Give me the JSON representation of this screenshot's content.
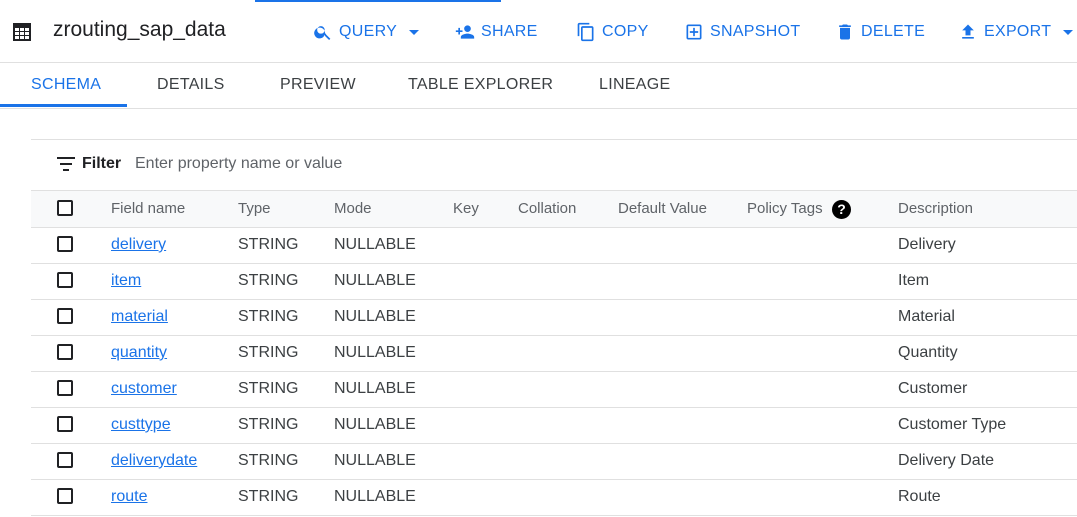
{
  "header": {
    "title": "zrouting_sap_data",
    "actions": {
      "query": "QUERY",
      "share": "SHARE",
      "copy": "COPY",
      "snapshot": "SNAPSHOT",
      "delete": "DELETE",
      "export": "EXPORT"
    }
  },
  "tabs": [
    "SCHEMA",
    "DETAILS",
    "PREVIEW",
    "TABLE EXPLORER",
    "LINEAGE"
  ],
  "active_tab": "SCHEMA",
  "filter": {
    "label": "Filter",
    "placeholder": "Enter property name or value"
  },
  "table": {
    "columns": [
      "Field name",
      "Type",
      "Mode",
      "Key",
      "Collation",
      "Default Value",
      "Policy Tags",
      "Description"
    ],
    "help_glyph": "?",
    "rows": [
      {
        "field": "delivery",
        "type": "STRING",
        "mode": "NULLABLE",
        "description": "Delivery"
      },
      {
        "field": "item",
        "type": "STRING",
        "mode": "NULLABLE",
        "description": "Item"
      },
      {
        "field": "material",
        "type": "STRING",
        "mode": "NULLABLE",
        "description": "Material"
      },
      {
        "field": "quantity",
        "type": "STRING",
        "mode": "NULLABLE",
        "description": "Quantity"
      },
      {
        "field": "customer",
        "type": "STRING",
        "mode": "NULLABLE",
        "description": "Customer"
      },
      {
        "field": "custtype",
        "type": "STRING",
        "mode": "NULLABLE",
        "description": "Customer Type"
      },
      {
        "field": "deliverydate",
        "type": "STRING",
        "mode": "NULLABLE",
        "description": "Delivery Date"
      },
      {
        "field": "route",
        "type": "STRING",
        "mode": "NULLABLE",
        "description": "Route"
      }
    ]
  },
  "colors": {
    "accent": "#1a73e8",
    "text": "#202124",
    "divider": "#e0e0e0"
  },
  "icons": [
    "table-icon",
    "search-icon",
    "person-add-icon",
    "copy-icon",
    "snapshot-icon",
    "trash-icon",
    "upload-icon",
    "filter-icon",
    "help-icon"
  ]
}
